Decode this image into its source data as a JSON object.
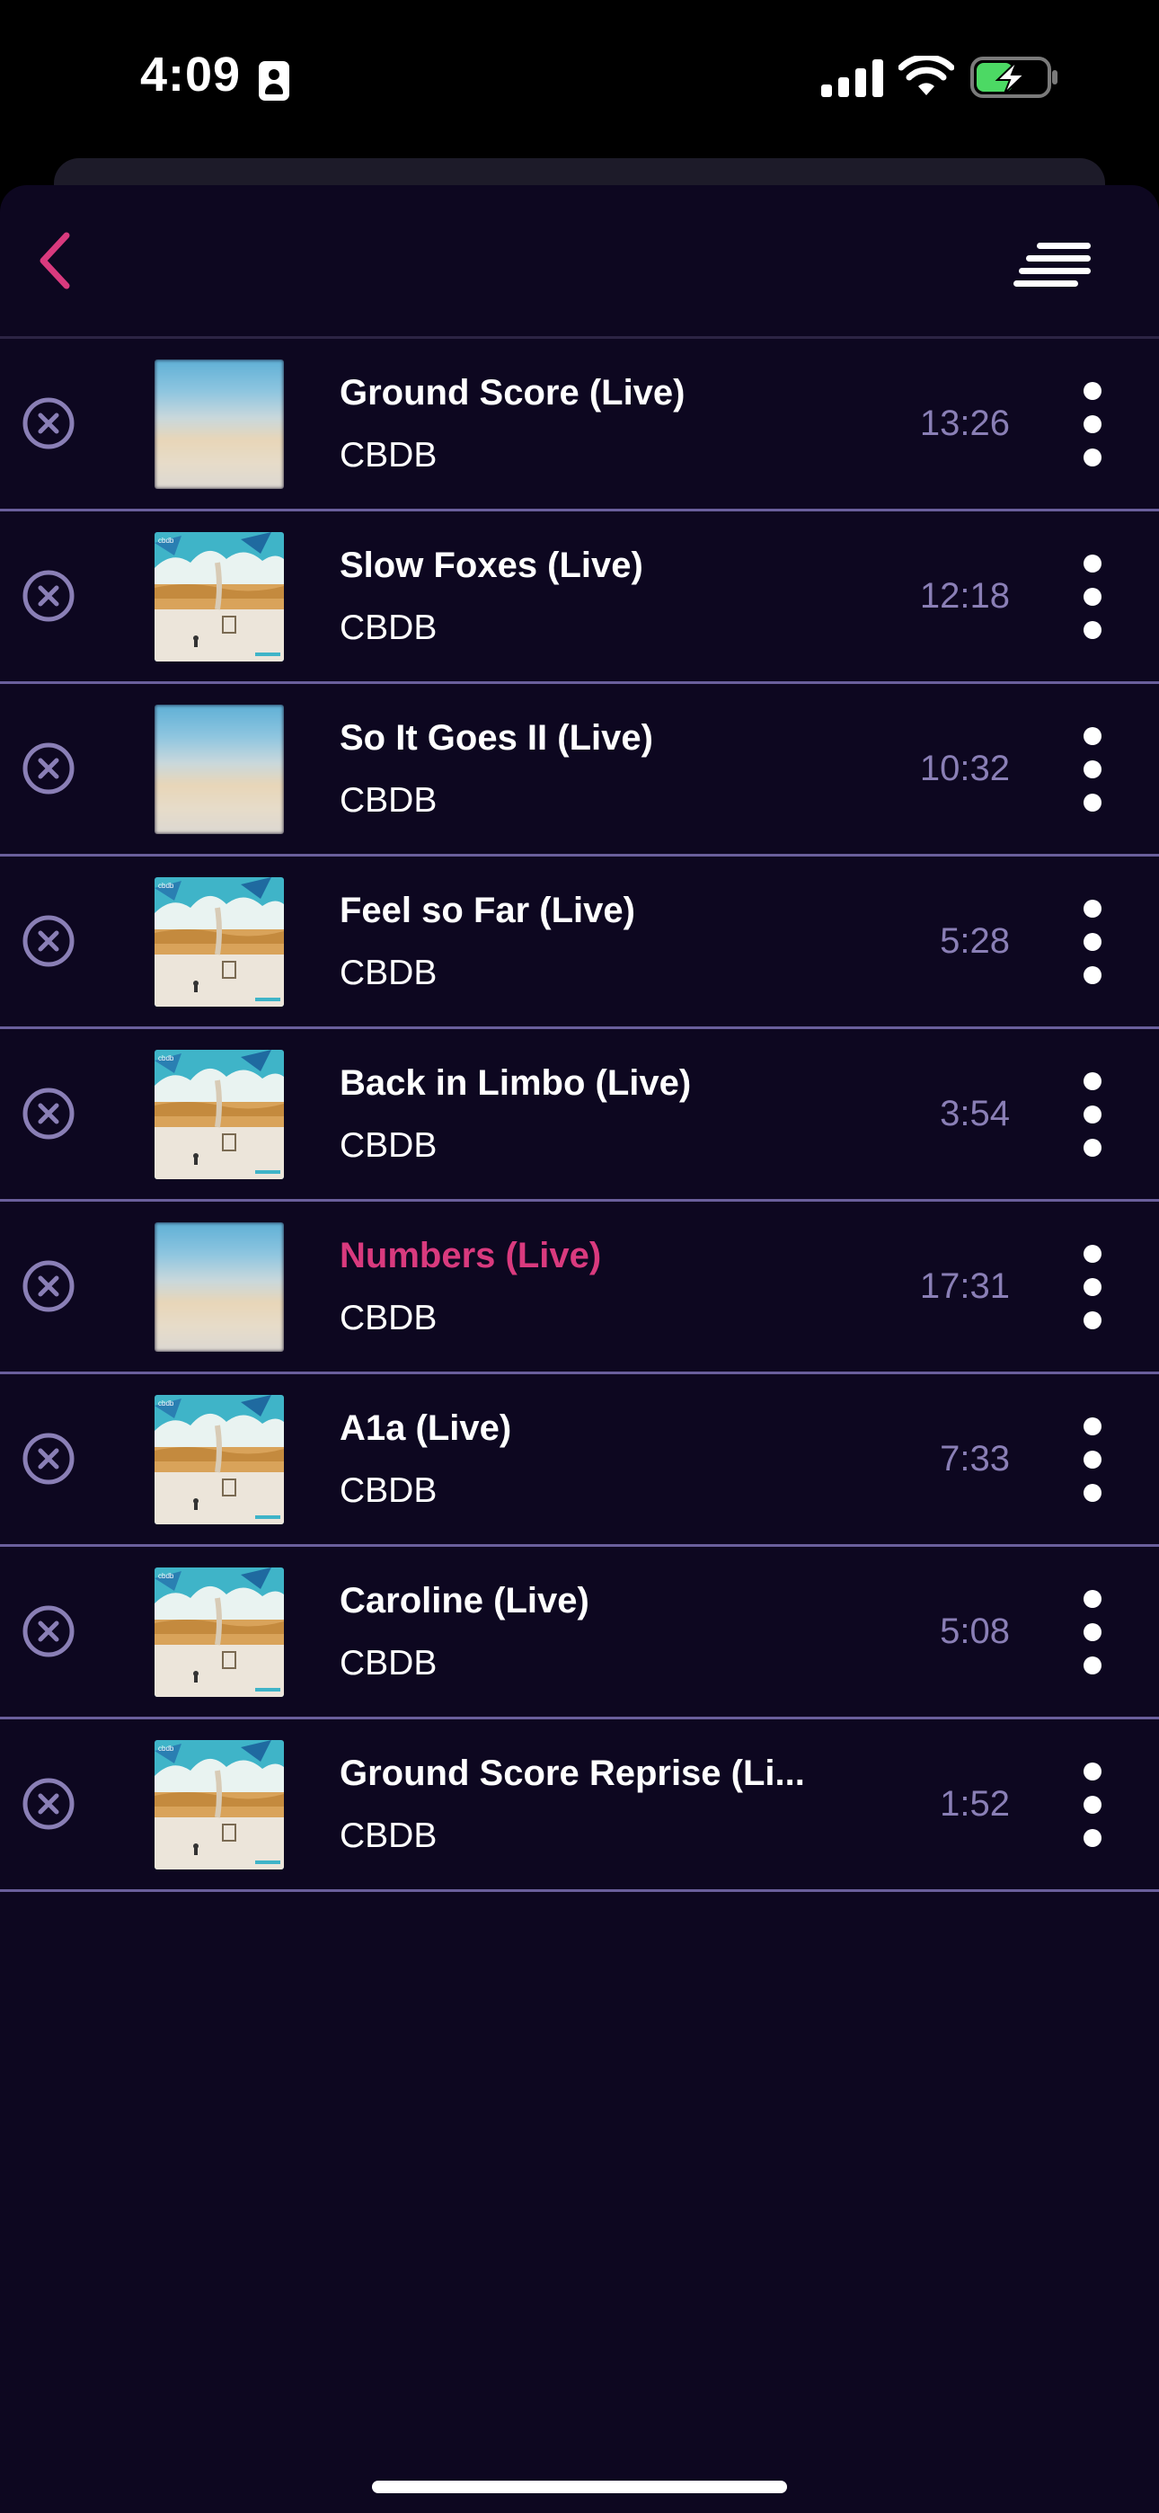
{
  "status_bar": {
    "time": "4:09",
    "icons": [
      "id-card-icon",
      "cellular-signal-icon",
      "wifi-icon",
      "battery-charging-icon"
    ]
  },
  "header": {
    "back_icon": "chevron-left-icon",
    "menu_icon": "queue-sort-icon"
  },
  "colors": {
    "background": "#0d0720",
    "accent": "#d93a7e",
    "divider": "#6a5f9c",
    "duration": "#8a7fb6",
    "remove_icon": "#8a7fb6"
  },
  "tracks": [
    {
      "title": "Ground Score (Live)",
      "artist": "CBDB",
      "duration": "13:26",
      "artwork": "blurred",
      "playing": false
    },
    {
      "title": "Slow Foxes (Live)",
      "artist": "CBDB",
      "duration": "12:18",
      "artwork": "album",
      "playing": false
    },
    {
      "title": "So It Goes II (Live)",
      "artist": "CBDB",
      "duration": "10:32",
      "artwork": "blurred",
      "playing": false
    },
    {
      "title": "Feel so Far (Live)",
      "artist": "CBDB",
      "duration": "5:28",
      "artwork": "album",
      "playing": false
    },
    {
      "title": "Back in Limbo (Live)",
      "artist": "CBDB",
      "duration": "3:54",
      "artwork": "album",
      "playing": false
    },
    {
      "title": "Numbers (Live)",
      "artist": "CBDB",
      "duration": "17:31",
      "artwork": "blurred",
      "playing": true
    },
    {
      "title": "A1a (Live)",
      "artist": "CBDB",
      "duration": "7:33",
      "artwork": "album",
      "playing": false
    },
    {
      "title": "Caroline (Live)",
      "artist": "CBDB",
      "duration": "5:08",
      "artwork": "album",
      "playing": false
    },
    {
      "title": "Ground Score Reprise (Li...",
      "artist": "CBDB",
      "duration": "1:52",
      "artwork": "album",
      "playing": false
    }
  ]
}
